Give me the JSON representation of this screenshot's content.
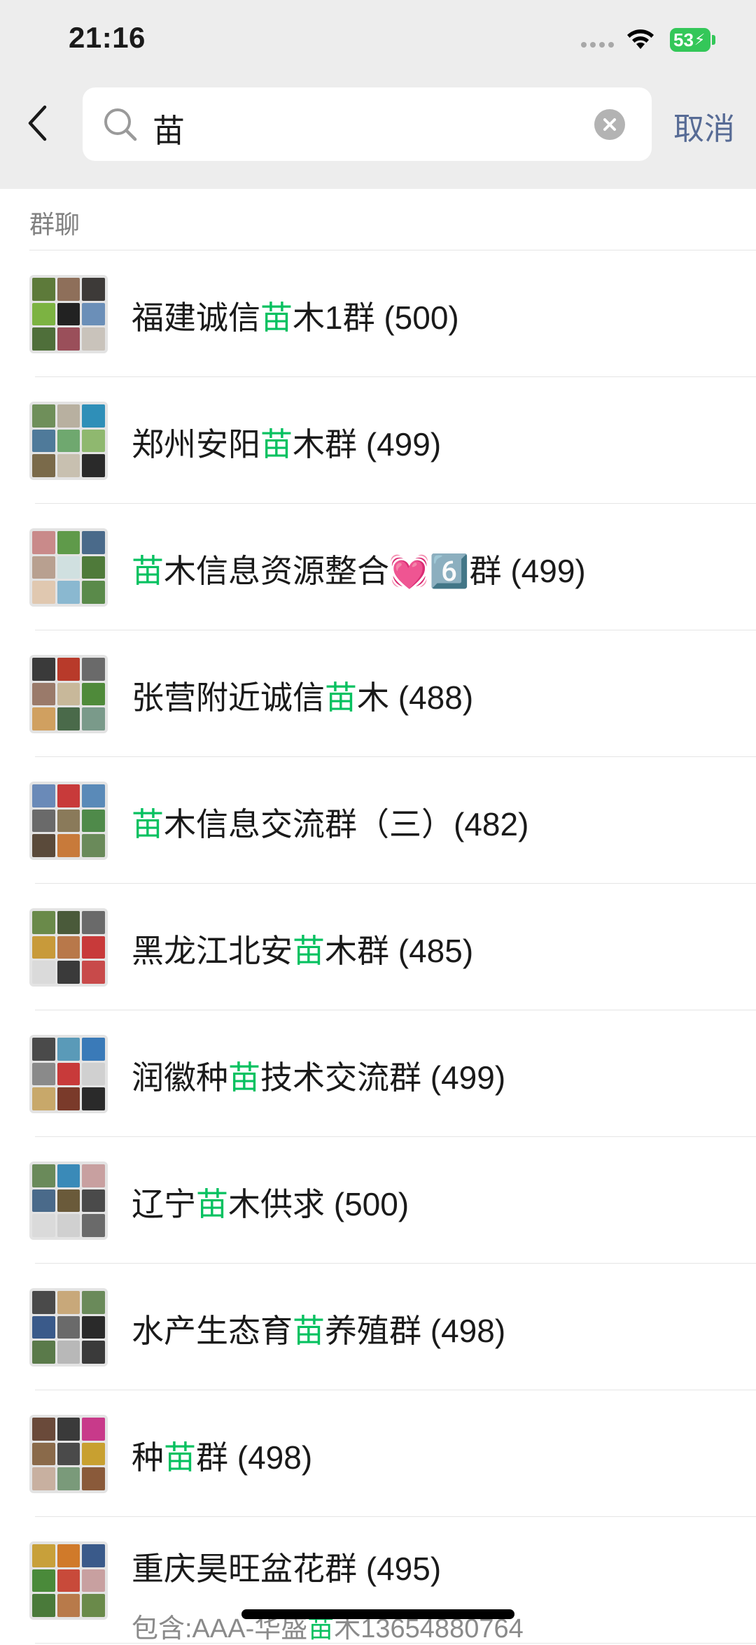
{
  "status_bar": {
    "time": "21:16",
    "battery": "53"
  },
  "search": {
    "query": "苗",
    "cancel_label": "取消"
  },
  "section": {
    "title": "群聊"
  },
  "groups": [
    {
      "before": "福建诚信",
      "match": "苗",
      "after": "木1群 (500)",
      "colors": [
        "#5d7a3a",
        "#8e6f5a",
        "#3d3a38",
        "#7cb342",
        "#222222",
        "#6b8fb8",
        "#4f6f3a",
        "#9a4f5a",
        "#c9c3bb"
      ]
    },
    {
      "before": "郑州安阳",
      "match": "苗",
      "after": "木群 (499)",
      "colors": [
        "#6f8f5a",
        "#b8b0a0",
        "#2f8fb8",
        "#4f7a9a",
        "#6fa86f",
        "#8fb86f",
        "#7a6a4a",
        "#c8c0b0",
        "#2a2a2a"
      ]
    },
    {
      "before": "",
      "match": "苗",
      "after": "木信息资源整合💓6️⃣群 (499)",
      "colors": [
        "#c98a8a",
        "#5f9a4a",
        "#4a6a8a",
        "#b8a090",
        "#d0e0e0",
        "#4f7a3a",
        "#e0c8b0",
        "#8ab8d0",
        "#5a8a4a"
      ]
    },
    {
      "before": "张营附近诚信",
      "match": "苗",
      "after": "木 (488)",
      "colors": [
        "#3a3a3a",
        "#b83a2a",
        "#6a6a6a",
        "#9a7a6a",
        "#c8b89a",
        "#4f8a3a",
        "#d0a060",
        "#4a6a4a",
        "#7a9a8a"
      ]
    },
    {
      "before": "",
      "match": "苗",
      "after": "木信息交流群（三）(482)",
      "colors": [
        "#6a8ab8",
        "#c83a3a",
        "#5a8ab8",
        "#6a6a6a",
        "#8a7a5a",
        "#4f8a4a",
        "#5a4a3a",
        "#c87a3a",
        "#6a8a5a"
      ]
    },
    {
      "before": "黑龙江北安",
      "match": "苗",
      "after": "木群 (485)",
      "colors": [
        "#6a8a4a",
        "#4a5a3a",
        "#6a6a6a",
        "#c89a3a",
        "#b8784a",
        "#c83a3a",
        "#dadada",
        "#3a3a3a",
        "#c84a4a"
      ]
    },
    {
      "before": "润徽种",
      "match": "苗",
      "after": "技术交流群 (499)",
      "colors": [
        "#4a4a4a",
        "#5a9ab8",
        "#3a7ab8",
        "#8a8a8a",
        "#c83a3a",
        "#d0d0d0",
        "#c8a86a",
        "#7a3a2a",
        "#2a2a2a"
      ]
    },
    {
      "before": "辽宁",
      "match": "苗",
      "after": "木供求 (500)",
      "colors": [
        "#6a8a5a",
        "#3a8ab8",
        "#c8a0a0",
        "#4a6a8a",
        "#6a5a3a",
        "#4a4a4a",
        "#dadada",
        "#d0d0d0",
        "#6a6a6a"
      ]
    },
    {
      "before": "水产生态育",
      "match": "苗",
      "after": "养殖群 (498)",
      "colors": [
        "#4a4a4a",
        "#c8a87a",
        "#6a8a5a",
        "#3a5a8a",
        "#6a6a6a",
        "#2a2a2a",
        "#5a7a4a",
        "#b8b8b8",
        "#3a3a3a"
      ]
    },
    {
      "before": "种",
      "match": "苗",
      "after": "群 (498)",
      "colors": [
        "#6a4a3a",
        "#3a3a3a",
        "#c83a8a",
        "#8a6a4a",
        "#4a4a4a",
        "#c8a030",
        "#c8b0a0",
        "#7a9a7a",
        "#8a5a3a"
      ]
    },
    {
      "before": "重庆昊旺盆花群 (495)",
      "match": "",
      "after": "",
      "sub_before": "包含:AAA-华盛",
      "sub_match": "苗",
      "sub_after": "木13654880764",
      "colors": [
        "#c8a03a",
        "#d07a2a",
        "#3a5a8a",
        "#4a8a3a",
        "#c84a3a",
        "#c8a0a0",
        "#4a7a3a",
        "#b87a4a",
        "#6a8a4a"
      ]
    }
  ]
}
